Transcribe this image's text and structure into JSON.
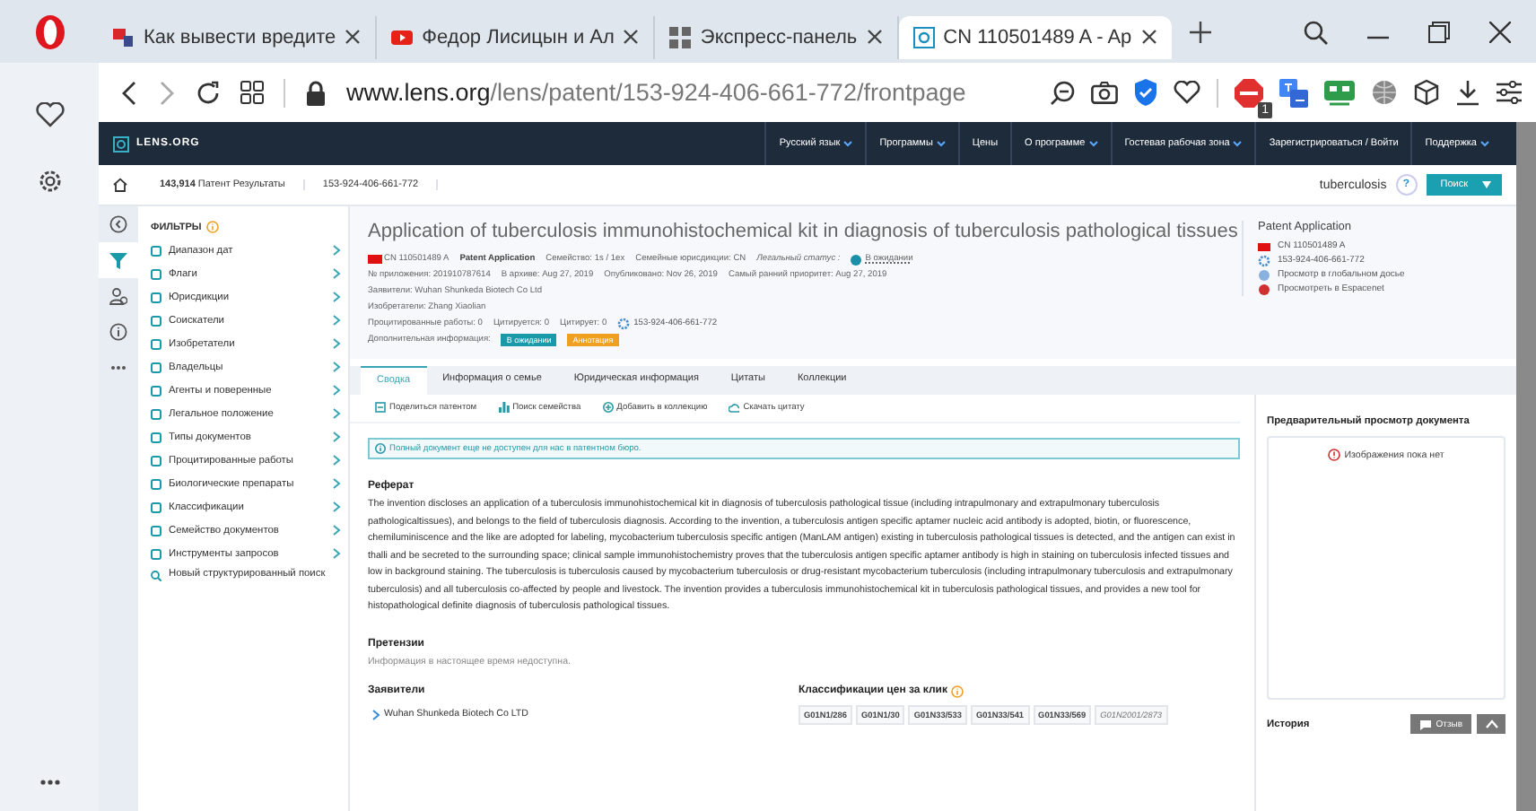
{
  "browser": {
    "tabs": [
      {
        "label": "Как вывести вредите",
        "selected": false
      },
      {
        "label": "Федор Лисицын и Ал",
        "selected": false
      },
      {
        "label": "Экспресс-панель",
        "selected": false
      },
      {
        "label": "CN 110501489 A - Ap",
        "selected": true
      }
    ],
    "url_host": "www.lens.org",
    "url_path": "/lens/patent/153-924-406-661-772/frontpage",
    "extension_badge": "1"
  },
  "site": {
    "logo": "LENS.ORG",
    "nav": [
      {
        "label": "Русский язык",
        "dropdown": true
      },
      {
        "label": "Программы",
        "dropdown": true
      },
      {
        "label": "Цены",
        "dropdown": false
      },
      {
        "label": "О программе",
        "dropdown": true
      },
      {
        "label": "Гостевая рабочая зона",
        "dropdown": true
      },
      {
        "label": "Зарегистрироваться  /  Войти",
        "dropdown": false
      },
      {
        "label": "Поддержка",
        "dropdown": true
      }
    ]
  },
  "breadcrumb": {
    "count": "143,914",
    "results": "Патент Результаты",
    "patent_id": "153-924-406-661-772"
  },
  "search": {
    "value": "tuberculosis",
    "help": "?",
    "button": "Поиск"
  },
  "rail": [
    {
      "selected": false
    },
    {
      "selected": true
    },
    {
      "selected": false
    },
    {
      "selected": false
    },
    {
      "selected": false
    }
  ],
  "filters": {
    "title": "ФИЛЬТРЫ",
    "items": [
      "Диапазон дат",
      "Флаги",
      "Юрисдикции",
      "Соискатели",
      "Изобретатели",
      "Владельцы",
      "Агенты и поверенные",
      "Легальное положение",
      "Типы документов",
      "Процитированные работы",
      "Биологические препараты",
      "Классификации",
      "Семейство документов",
      "Инструменты запросов"
    ],
    "structured_search": "Новый структурированный поиск"
  },
  "patent": {
    "title": "Application of tuberculosis immunohistochemical kit in diagnosis of tuberculosis pathological tissues",
    "number": "CN 110501489 A",
    "type": "Patent Application",
    "family": "Семейство: 1s / 1ex",
    "family_jurisdictions": "Семейные юрисдикции: CN",
    "legal_status_label": "Легальный статус :",
    "legal_status": "В ожидании",
    "dates": [
      "№ приложения: 201910787614",
      "В архиве: Aug 27, 2019",
      "Опубликовано: Nov 26, 2019",
      "Самый ранний приоритет: Aug 27, 2019"
    ],
    "applicants": "Заявители: Wuhan Shunkeda Biotech Co Ltd",
    "inventors": "Изобретатели: Zhang Xiaolian",
    "citations": [
      "Процитированные работы: 0",
      "Цитируется: 0",
      "Цитирует: 0"
    ],
    "lens_id": "153-924-406-661-772",
    "extra_label": "Дополнительная информация:",
    "badges": [
      {
        "label": "В ожидании",
        "color": "#1a9aa8"
      },
      {
        "label": "Аннотация",
        "color": "#f0a020"
      }
    ]
  },
  "side_info": {
    "title": "Patent Application",
    "links": [
      "CN 110501489 A",
      "153-924-406-661-772",
      "Просмотр в глобальном досье",
      "Просмотреть в Espacenet"
    ]
  },
  "tabs": [
    {
      "label": "Сводка",
      "selected": true
    },
    {
      "label": "Информация о семье",
      "selected": false
    },
    {
      "label": "Юридическая информация",
      "selected": false
    },
    {
      "label": "Цитаты",
      "selected": false
    },
    {
      "label": "Коллекции",
      "selected": false
    }
  ],
  "actions": [
    "Поделиться патентом",
    "Поиск семейства",
    "Добавить в коллекцию",
    "Скачать цитату"
  ],
  "notice": "Полный документ еще не доступен для нас в патентном бюро.",
  "abstract": {
    "heading": "Реферат",
    "text": "The invention discloses an application of a tuberculosis immunohistochemical kit in diagnosis of tuberculosis pathological tissue (including intrapulmonary and extrapulmonary tuberculosis pathologicaltissues), and belongs to the field of tuberculosis diagnosis. According to the invention, a tuberculosis antigen specific aptamer nucleic acid antibody is adopted, biotin, or fluorescence, chemiluminiscence and the like are adopted for labeling, mycobacterium tuberculosis specific antigen (ManLAM antigen) existing in tuberculosis pathological tissues is detected, and the antigen can exist in thalli and be secreted to the surrounding space; clinical sample immunohistochemistry proves that the tuberculosis antigen specific aptamer antibody is high in staining on tuberculosis infected tissues and low in background staining. The tuberculosis is tuberculosis caused by mycobacterium tuberculosis or drug-resistant mycobacterium tuberculosis (including intrapulmonary tuberculosis and extrapulmonary tuberculosis) and all tuberculosis co-affected by people and livestock. The invention provides a tuberculosis immunohistochemical kit in tuberculosis pathological tissues, and provides a new tool for histopathological definite diagnosis of tuberculosis pathological tissues."
  },
  "claims": {
    "heading": "Претензии",
    "text": "Информация в настоящее время недоступна."
  },
  "applicants_section": {
    "heading": "Заявители",
    "items": [
      "Wuhan Shunkeda Biotech Co LTD"
    ]
  },
  "cpc": {
    "heading": "Классификации цен за клик",
    "codes": [
      {
        "code": "G01N1/286",
        "italic": false
      },
      {
        "code": "G01N1/30",
        "italic": false
      },
      {
        "code": "G01N33/533",
        "italic": false
      },
      {
        "code": "G01N33/541",
        "italic": false
      },
      {
        "code": "G01N33/569",
        "italic": false
      },
      {
        "code": "G01N2001/2873",
        "italic": true
      }
    ]
  },
  "preview": {
    "heading": "Предварительный просмотр документа",
    "empty": "Изображения пока нет"
  },
  "history": {
    "heading": "История"
  },
  "feedback": {
    "label": "Отзыв"
  }
}
